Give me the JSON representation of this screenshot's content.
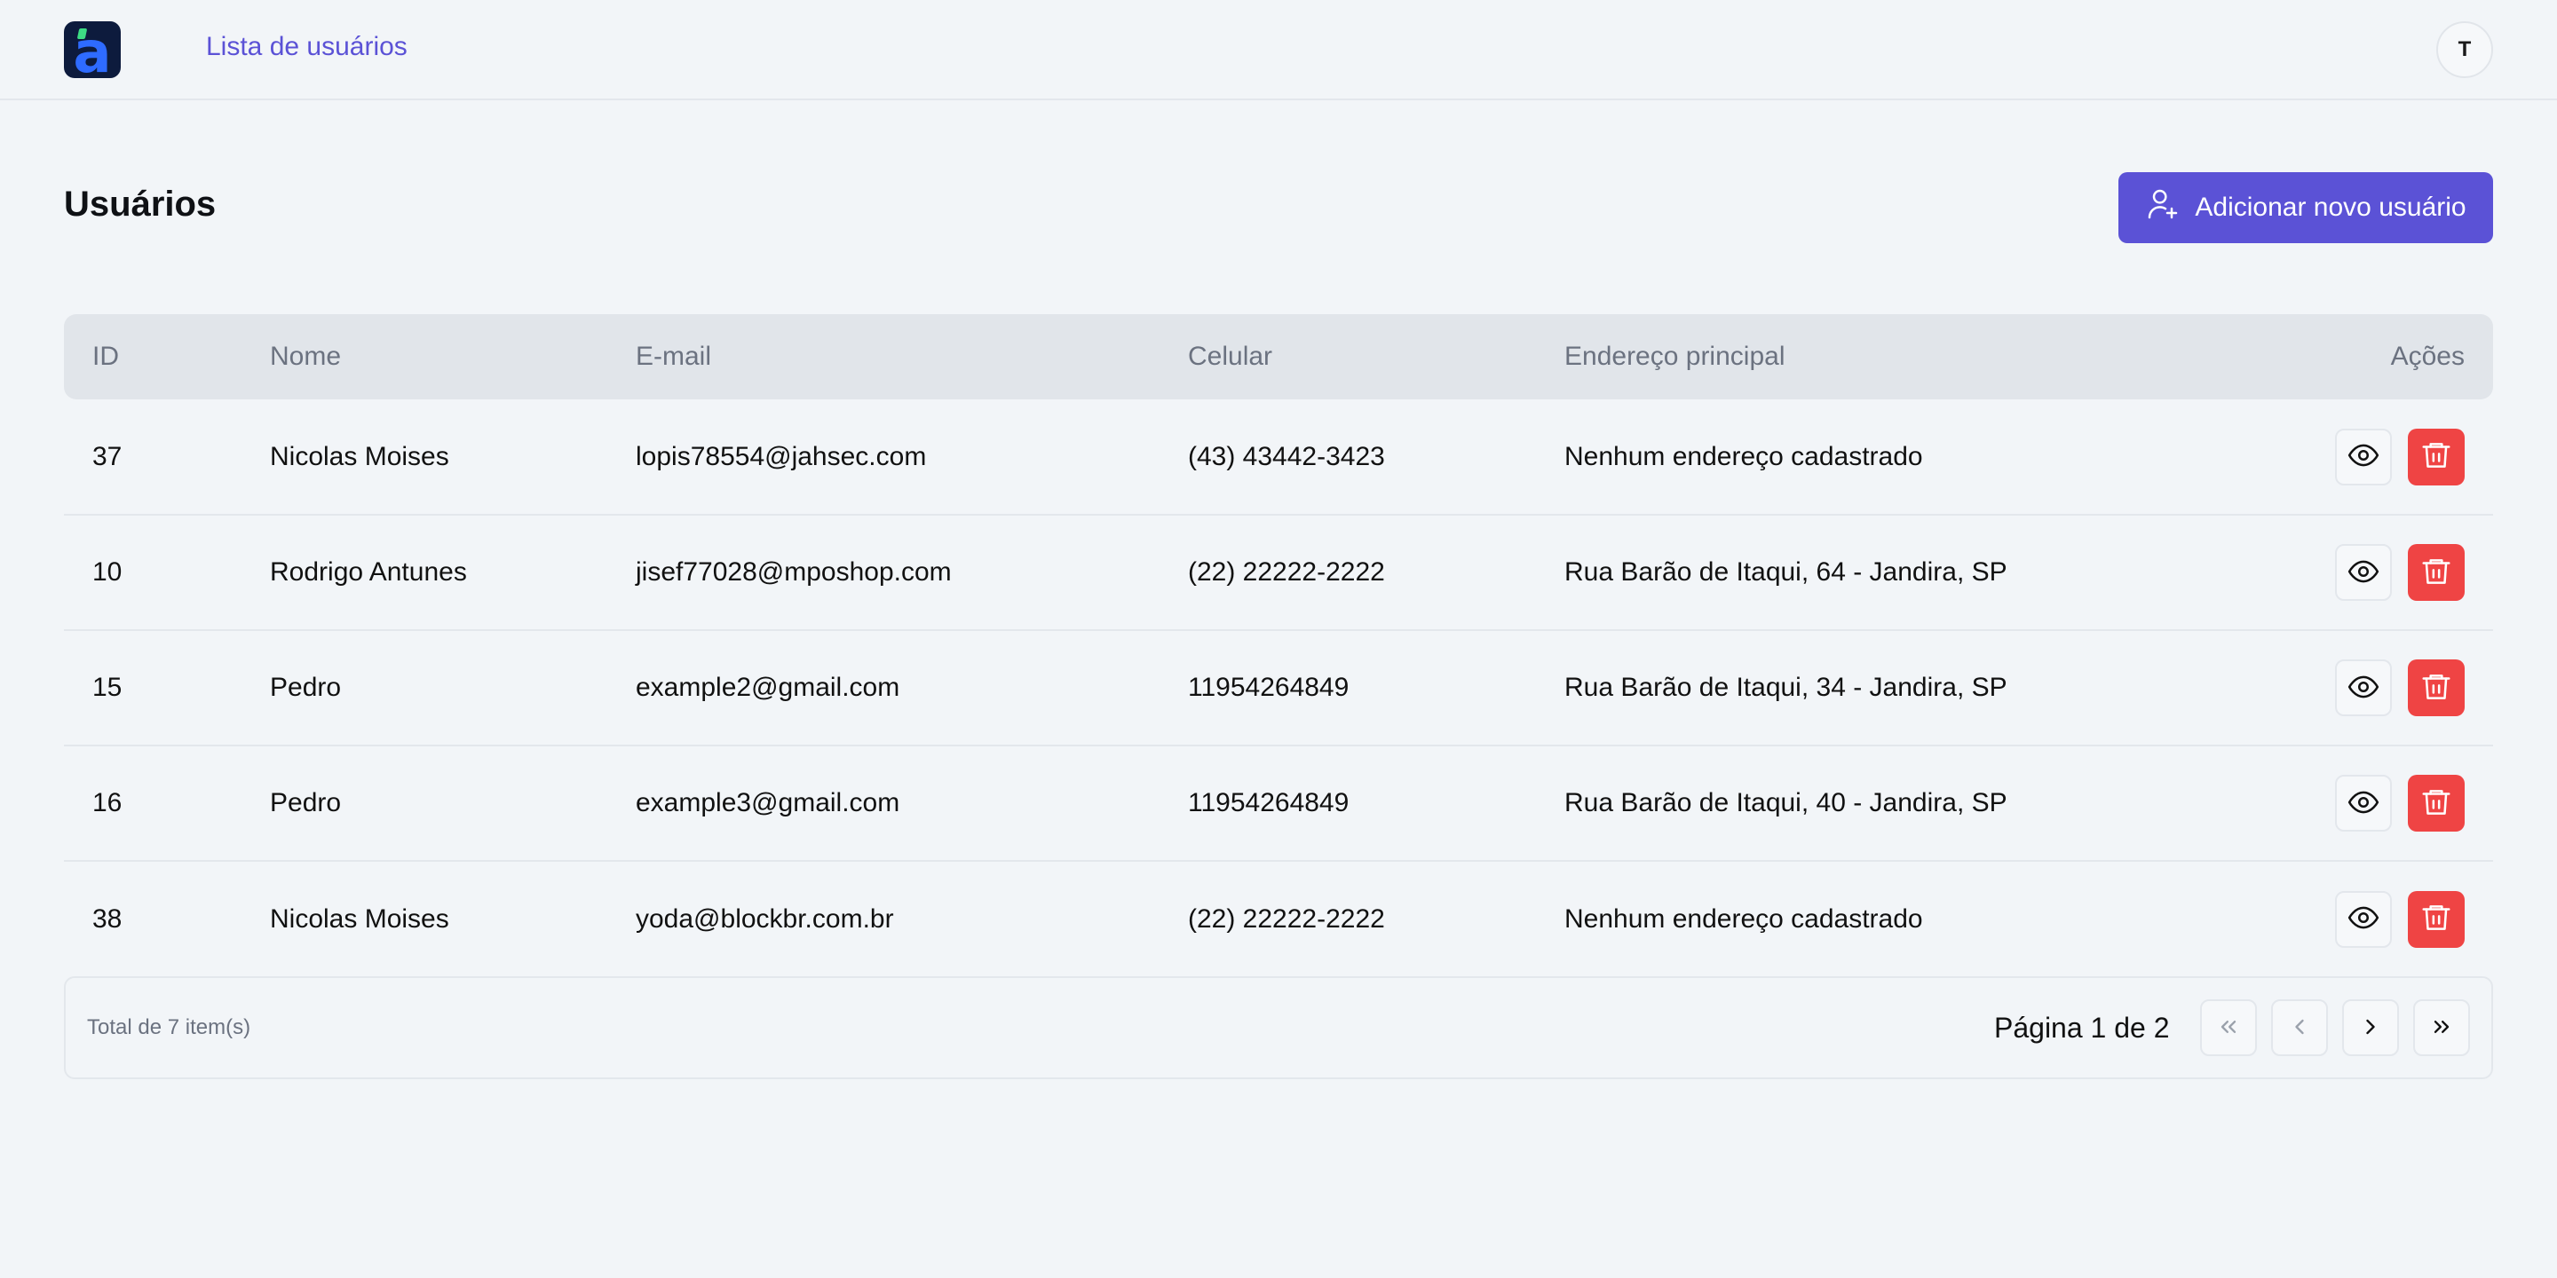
{
  "header": {
    "logo_letter": "a",
    "nav_link": "Lista de usuários",
    "avatar_initial": "T"
  },
  "main": {
    "title": "Usuários",
    "add_button_label": "Adicionar novo usuário"
  },
  "table": {
    "columns": [
      "ID",
      "Nome",
      "E-mail",
      "Celular",
      "Endereço principal",
      "Ações"
    ],
    "rows": [
      {
        "id": "37",
        "name": "Nicolas Moises",
        "email": "lopis78554@jahsec.com",
        "phone": "(43) 43442-3423",
        "address": "Nenhum endereço cadastrado"
      },
      {
        "id": "10",
        "name": "Rodrigo Antunes",
        "email": "jisef77028@mposhop.com",
        "phone": "(22) 22222-2222",
        "address": "Rua Barão de Itaqui, 64 - Jandira, SP"
      },
      {
        "id": "15",
        "name": "Pedro",
        "email": "example2@gmail.com",
        "phone": "11954264849",
        "address": "Rua Barão de Itaqui, 34 - Jandira, SP"
      },
      {
        "id": "16",
        "name": "Pedro",
        "email": "example3@gmail.com",
        "phone": "11954264849",
        "address": "Rua Barão de Itaqui, 40 - Jandira, SP"
      },
      {
        "id": "38",
        "name": "Nicolas Moises",
        "email": "yoda@blockbr.com.br",
        "phone": "(22) 22222-2222",
        "address": "Nenhum endereço cadastrado"
      }
    ]
  },
  "footer": {
    "total_text": "Total de 7 item(s)",
    "page_text": "Página 1 de 2"
  },
  "icons": {
    "add_user": "user-plus-icon",
    "view": "eye-icon",
    "delete": "trash-icon",
    "first": "chevrons-left-icon",
    "prev": "chevron-left-icon",
    "next": "chevron-right-icon",
    "last": "chevrons-right-icon"
  },
  "colors": {
    "accent": "#5b52d6",
    "danger": "#ef4444",
    "background": "#f2f5f8",
    "header_row": "#e1e5ea"
  }
}
